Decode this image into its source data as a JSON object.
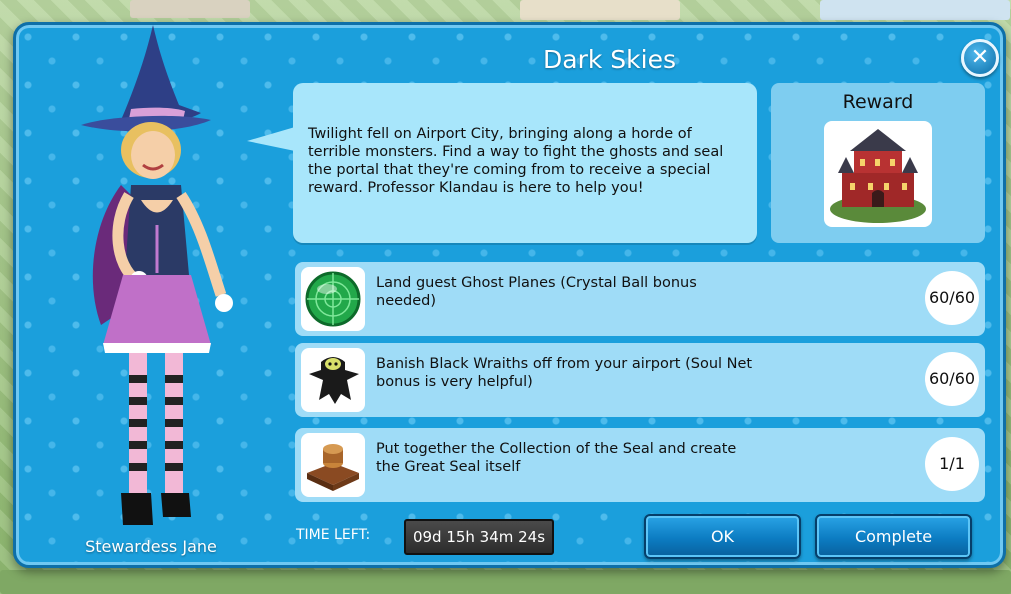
{
  "dialog": {
    "title": "Dark Skies",
    "close_label": "✕"
  },
  "character": {
    "name": "Stewardess Jane"
  },
  "story": {
    "text": "Twilight fell on Airport City, bringing along a horde of terrible monsters. Find a way to fight the ghosts and seal the portal that they're coming from to receive a special reward. Professor Klandau is here to help you!"
  },
  "reward": {
    "title": "Reward",
    "icon": "castle-icon"
  },
  "tasks": [
    {
      "text": "Land guest Ghost Planes (Crystal Ball bonus needed)",
      "count": "60/60",
      "icon": "radar-icon"
    },
    {
      "text": "Banish Black Wraiths off from your airport (Soul Net bonus is very helpful)",
      "count": "60/60",
      "icon": "wraith-icon"
    },
    {
      "text": "Put together the Collection of the Seal and create the Great Seal itself",
      "count": "1/1",
      "icon": "seal-icon"
    }
  ],
  "timer": {
    "label": "TIME LEFT:",
    "value": "09d 15h 34m 24s"
  },
  "buttons": {
    "ok": "OK",
    "complete": "Complete"
  },
  "colors": {
    "panel": "#1b9fdc",
    "speech": "#a8e6fb",
    "task_bg": "#9fdcf7",
    "button": "#0c7cc2"
  }
}
